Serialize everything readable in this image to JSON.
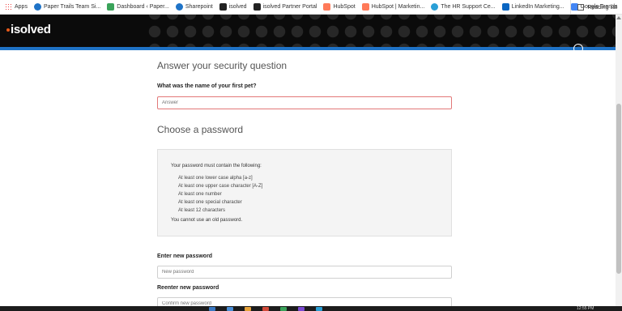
{
  "bookmarks": {
    "items": [
      {
        "label": "Apps",
        "color": "#e04a3a"
      },
      {
        "label": "Paper Trails Team Si...",
        "color": "#1f73c7"
      },
      {
        "label": "Dashboard ‹ Paper...",
        "color": "#3aa35a"
      },
      {
        "label": "Sharepoint",
        "color": "#1f73c7"
      },
      {
        "label": "isolved",
        "color": "#222222"
      },
      {
        "label": "isolved Partner Portal",
        "color": "#222222"
      },
      {
        "label": "HubSpot",
        "color": "#ff7a59"
      },
      {
        "label": "HubSpot | Marketin...",
        "color": "#ff7a59"
      },
      {
        "label": "The HR Support Ce...",
        "color": "#2a9fd6"
      },
      {
        "label": "LinkedIn Marketing...",
        "color": "#0a66c2"
      },
      {
        "label": "Google Trends",
        "color": "#4285f4"
      }
    ],
    "more": "»",
    "reading_list": "Reading list"
  },
  "header": {
    "logo": "isolved",
    "brand_accent": "#e85a1b",
    "band_color": "#1f73c7"
  },
  "security": {
    "title": "Answer your security question",
    "question": "What was the name of your first pet?",
    "answer_placeholder": "Answer",
    "answer_value": ""
  },
  "password": {
    "title": "Choose a password",
    "rules_heading": "Your password must contain the following:",
    "rules": [
      "At least one lower case alpha [a-z]",
      "At least one upper case character [A-Z]",
      "At least one number",
      "At least one special character",
      "At least 12 characters"
    ],
    "rules_note": "You cannot use an old password.",
    "new_label": "Enter new password",
    "new_placeholder": "New password",
    "confirm_label": "Reenter new password",
    "confirm_placeholder": "Confirm new password"
  },
  "taskbar": {
    "clock": "12:55 PM"
  }
}
